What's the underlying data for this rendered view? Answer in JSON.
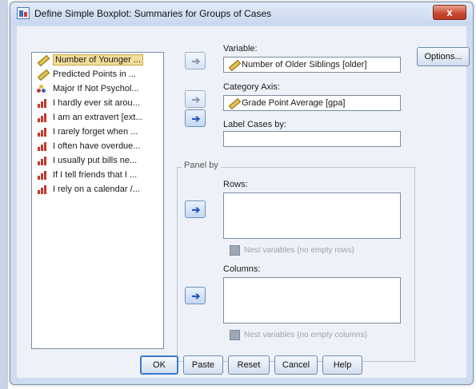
{
  "window": {
    "title": "Define Simple Boxplot: Summaries for Groups of Cases",
    "close_label": "x"
  },
  "variables": [
    {
      "label": "Number of Younger ...",
      "icon": "ruler-icon",
      "selected": true
    },
    {
      "label": "Predicted Points in ...",
      "icon": "ruler-icon"
    },
    {
      "label": "Major If Not Psychol...",
      "icon": "nominal-icon"
    },
    {
      "label": "I hardly ever sit arou...",
      "icon": "ordinal-icon"
    },
    {
      "label": "I am an extravert [ext...",
      "icon": "ordinal-icon"
    },
    {
      "label": "I rarely forget when ...",
      "icon": "ordinal-icon"
    },
    {
      "label": "I often have overdue...",
      "icon": "ordinal-icon"
    },
    {
      "label": "I usually put bills ne...",
      "icon": "ordinal-icon"
    },
    {
      "label": "If I tell friends that I ...",
      "icon": "ordinal-icon"
    },
    {
      "label": "I rely on a calendar /...",
      "icon": "ordinal-icon"
    }
  ],
  "fields": {
    "variable_label": "Variable:",
    "variable_value": "Number of Older Siblings [older]",
    "category_label": "Category Axis:",
    "category_value": "Grade Point Average [gpa]",
    "label_cases_label": "Label Cases by:",
    "label_cases_value": ""
  },
  "panel": {
    "title": "Panel by",
    "rows_label": "Rows:",
    "rows_nest_label": "Nest variables (no empty rows)",
    "columns_label": "Columns:",
    "columns_nest_label": "Nest variables (no empty columns)"
  },
  "buttons": {
    "options": "Options...",
    "ok": "OK",
    "paste": "Paste",
    "reset": "Reset",
    "cancel": "Cancel",
    "help": "Help"
  },
  "arrow_glyph": "➔",
  "colors": {
    "selection": "#f2dd9a",
    "accent": "#2a55c8",
    "title_close": "#c8452e"
  }
}
